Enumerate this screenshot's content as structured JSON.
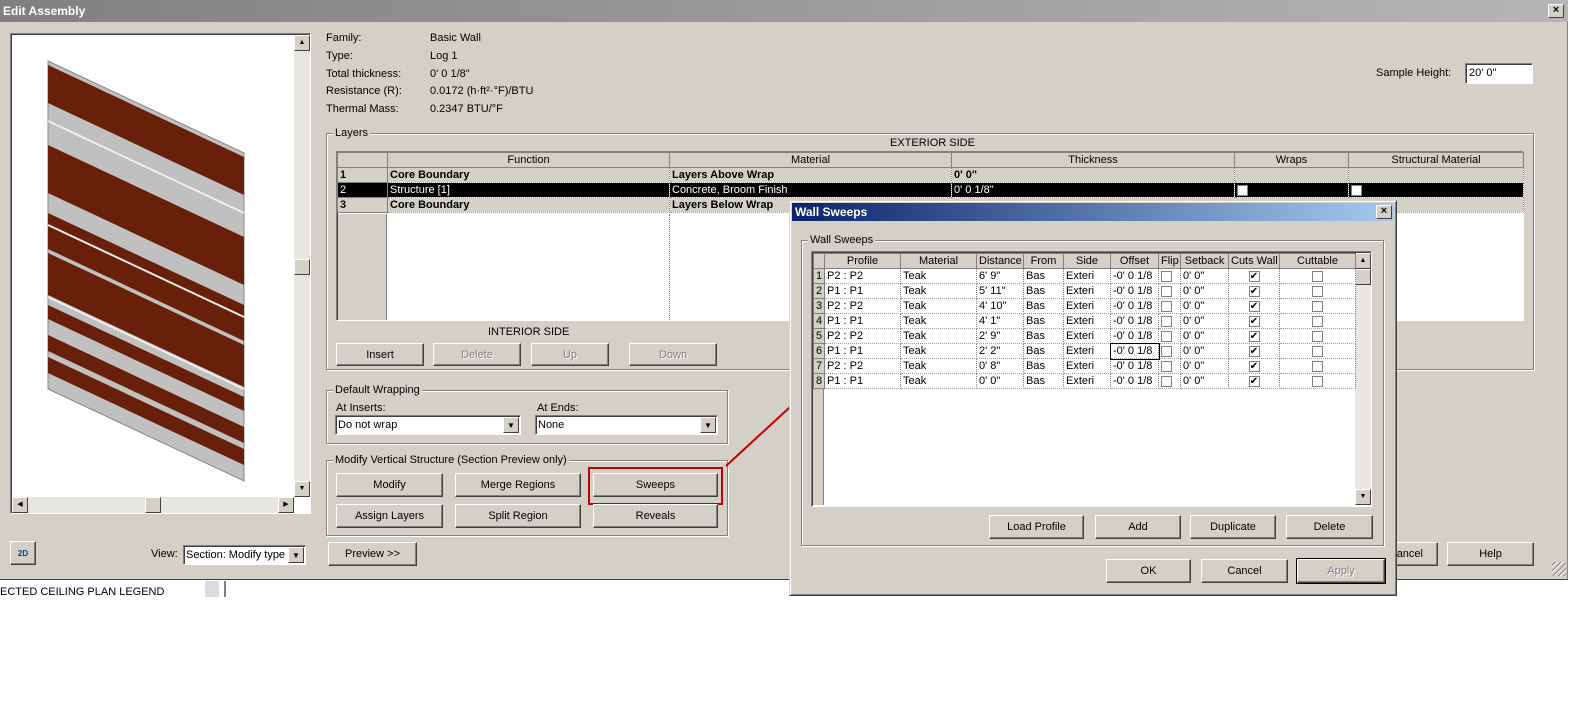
{
  "window": {
    "title": "Edit Assembly",
    "close": "×"
  },
  "properties": [
    {
      "label": "Family:",
      "value": "Basic Wall"
    },
    {
      "label": "Type:",
      "value": "Log 1"
    },
    {
      "label": "Total thickness:",
      "value": "0'  0 1/8\""
    },
    {
      "label": "Resistance (R):",
      "value": "0.0172 (h·ft²·°F)/BTU"
    },
    {
      "label": "Thermal Mass:",
      "value": "0.2347 BTU/°F"
    }
  ],
  "sample_height": {
    "label": "Sample Height:",
    "value": "20'  0\""
  },
  "layers": {
    "group_label": "Layers",
    "exterior": "EXTERIOR SIDE",
    "interior": "INTERIOR SIDE",
    "columns": [
      "",
      "Function",
      "Material",
      "Thickness",
      "Wraps",
      "Structural Material"
    ],
    "rows": [
      {
        "n": "1",
        "function": "Core Boundary",
        "material": "Layers Above Wrap",
        "thickness": "0'  0\"",
        "wraps": null,
        "structural": null,
        "style": "gr"
      },
      {
        "n": "2",
        "function": "Structure [1]",
        "material": "Concrete, Broom Finish",
        "thickness": "0'  0 1/8\"",
        "wraps": false,
        "structural": true,
        "style": "hl"
      },
      {
        "n": "3",
        "function": "Core Boundary",
        "material": "Layers Below Wrap",
        "thickness": "",
        "wraps": null,
        "structural": null,
        "style": "gr"
      }
    ],
    "buttons": {
      "insert": "Insert",
      "delete": "Delete",
      "up": "Up",
      "down": "Down"
    }
  },
  "default_wrapping": {
    "label": "Default Wrapping",
    "at_inserts_label": "At Inserts:",
    "at_inserts": "Do not wrap",
    "at_ends_label": "At  Ends:",
    "at_ends": "None"
  },
  "modify_vertical": {
    "label": "Modify Vertical Structure (Section Preview only)",
    "modify": "Modify",
    "merge": "Merge Regions",
    "sweeps": "Sweeps",
    "assign": "Assign Layers",
    "split": "Split Region",
    "reveals": "Reveals"
  },
  "bottom": {
    "view_label": "View:",
    "view": "Section: Modify type",
    "preview": "Preview >>",
    "cancel": "Cancel",
    "help": "Help",
    "icon_2d": "2D"
  },
  "background_text": "ECTED CEILING PLAN LEGEND",
  "highlight_color": "#c00000",
  "wall_sweeps": {
    "title": "Wall Sweeps",
    "close": "×",
    "group_label": "Wall Sweeps",
    "columns": [
      "",
      "Profile",
      "Material",
      "Distance",
      "From",
      "Side",
      "Offset",
      "Flip",
      "Setback",
      "Cuts Wall",
      "Cuttable"
    ],
    "rows": [
      {
        "n": "1",
        "profile": "P2 : P2",
        "material": "Teak",
        "distance": "6'  9\"",
        "from": "Bas",
        "side": "Exteri",
        "offset": "-0'  0 1/8",
        "flip": false,
        "setback": "0'  0\"",
        "cuts_wall": true,
        "cuttable": false
      },
      {
        "n": "2",
        "profile": "P1 : P1",
        "material": "Teak",
        "distance": "5'  11\"",
        "from": "Bas",
        "side": "Exteri",
        "offset": "-0'  0 1/8",
        "flip": false,
        "setback": "0'  0\"",
        "cuts_wall": true,
        "cuttable": false
      },
      {
        "n": "3",
        "profile": "P2 : P2",
        "material": "Teak",
        "distance": "4'  10\"",
        "from": "Bas",
        "side": "Exteri",
        "offset": "-0'  0 1/8",
        "flip": false,
        "setback": "0'  0\"",
        "cuts_wall": true,
        "cuttable": false
      },
      {
        "n": "4",
        "profile": "P1 : P1",
        "material": "Teak",
        "distance": "4'  1\"",
        "from": "Bas",
        "side": "Exteri",
        "offset": "-0'  0 1/8",
        "flip": false,
        "setback": "0'  0\"",
        "cuts_wall": true,
        "cuttable": false
      },
      {
        "n": "5",
        "profile": "P2 : P2",
        "material": "Teak",
        "distance": "2'  9\"",
        "from": "Bas",
        "side": "Exteri",
        "offset": "-0'  0 1/8",
        "flip": false,
        "setback": "0'  0\"",
        "cuts_wall": true,
        "cuttable": false
      },
      {
        "n": "6",
        "profile": "P1 : P1",
        "material": "Teak",
        "distance": "2'  2\"",
        "from": "Bas",
        "side": "Exteri",
        "offset": "-0'  0 1/8",
        "flip": false,
        "setback": "0'  0\"",
        "cuts_wall": true,
        "cuttable": false
      },
      {
        "n": "7",
        "profile": "P2 : P2",
        "material": "Teak",
        "distance": "0'  8\"",
        "from": "Bas",
        "side": "Exteri",
        "offset": "-0'  0 1/8",
        "flip": false,
        "setback": "0'  0\"",
        "cuts_wall": true,
        "cuttable": false
      },
      {
        "n": "8",
        "profile": "P1 : P1",
        "material": "Teak",
        "distance": "0'  0\"",
        "from": "Bas",
        "side": "Exteri",
        "offset": "-0'  0 1/8",
        "flip": false,
        "setback": "0'  0\"",
        "cuts_wall": true,
        "cuttable": false
      }
    ],
    "buttons": {
      "load_profile": "Load Profile",
      "add": "Add",
      "duplicate": "Duplicate",
      "delete": "Delete",
      "ok": "OK",
      "cancel": "Cancel",
      "apply": "Apply"
    }
  }
}
